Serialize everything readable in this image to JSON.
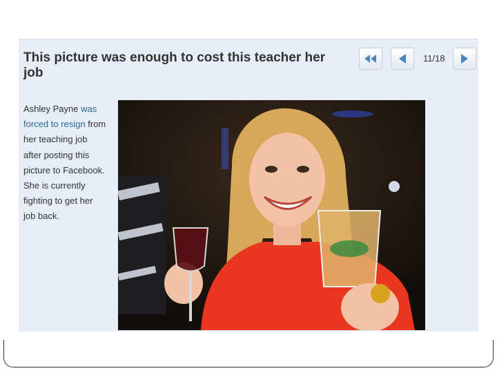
{
  "slideshow": {
    "title": "This picture was enough to cost this teacher her job",
    "counter": "11/18",
    "caption": {
      "before": "Ashley Payne",
      "link": "was forced to resign",
      "after": "from her teaching job after posting this picture to Facebook. She is currently fighting to get her job back."
    },
    "nav": {
      "first_icon": "double-left-arrow-icon",
      "prev_icon": "left-arrow-icon",
      "next_icon": "right-arrow-icon"
    },
    "colors": {
      "panel_bg": "#e6edf5",
      "link": "#2b6a96",
      "arrow": "#4a86c0",
      "title": "#333333"
    }
  }
}
